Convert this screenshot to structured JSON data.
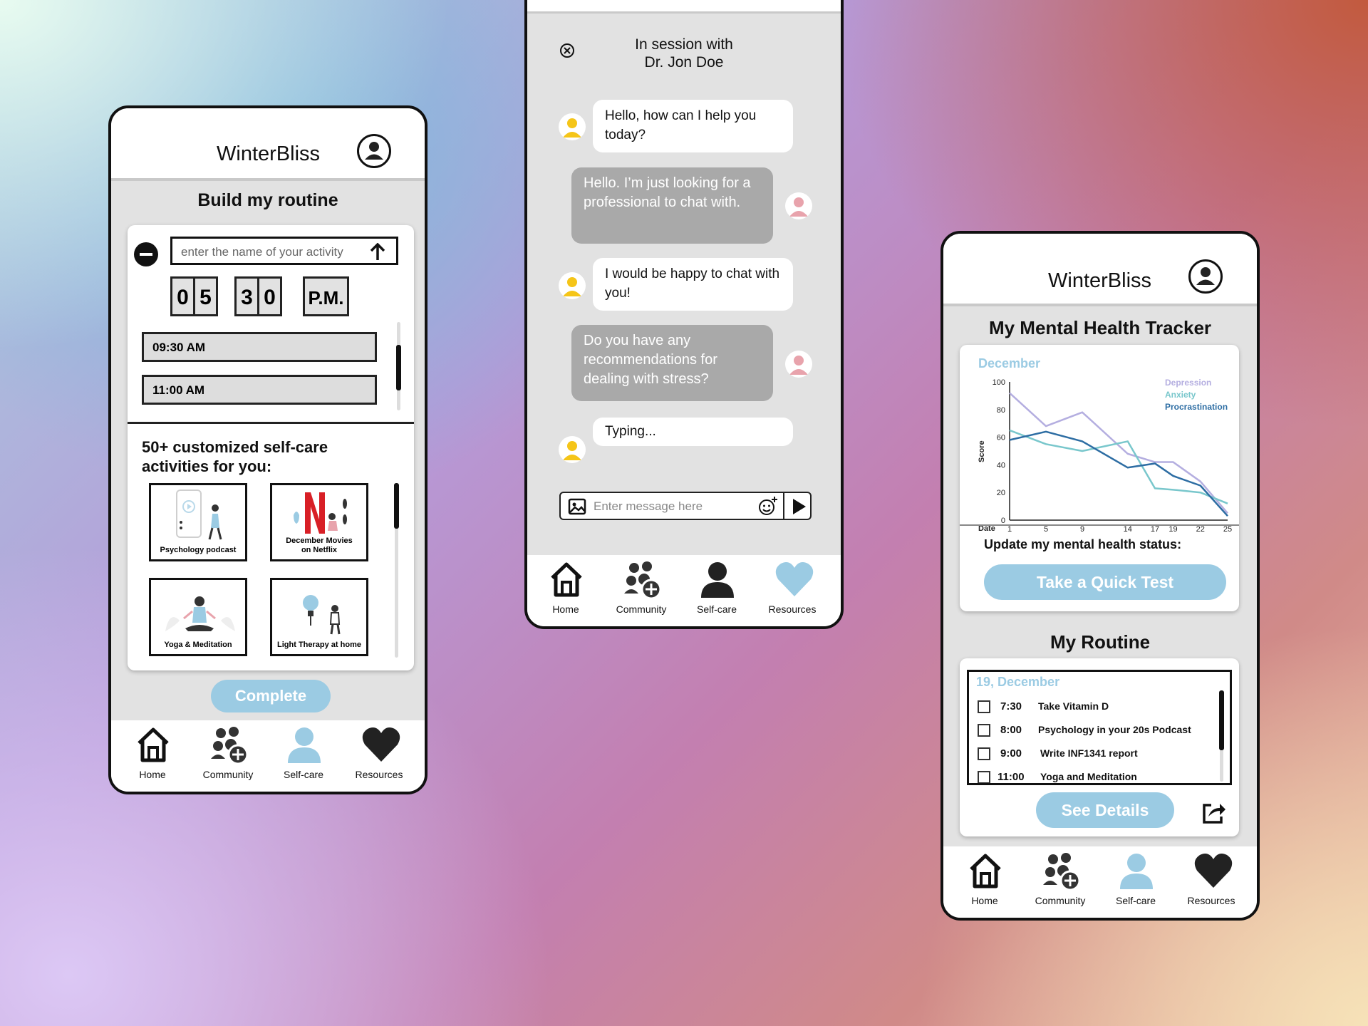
{
  "colors": {
    "accent": "#9bcbe3",
    "depression": "#b4aee0",
    "anxiety": "#79c7cc",
    "procrastination": "#2d6da3",
    "bubble_out": "#a9a9a9",
    "avatar_yellow": "#f5c518",
    "avatar_pink": "#e8a3ac"
  },
  "routine_screen": {
    "app_title": "WinterBliss",
    "heading": "Build my routine",
    "activity_input_placeholder": "enter the name of your activity",
    "time_digits": [
      "0",
      "5",
      "3",
      "0"
    ],
    "ampm": "P.M.",
    "slots": [
      "09:30 AM",
      "11:00 AM"
    ],
    "activities_heading": "50+ customized self-care activities for you:",
    "activities": [
      "Psychology podcast",
      "December Movies on Netflix",
      "Yoga & Meditation",
      "Light Therapy at home"
    ],
    "complete_label": "Complete"
  },
  "chat_screen": {
    "session_line1": "In session with",
    "session_line2": "Dr. Jon Doe",
    "messages": [
      {
        "from": "doctor",
        "text": "Hello, how can I help you today?"
      },
      {
        "from": "user",
        "text": "Hello. I’m just looking for a professional to chat with."
      },
      {
        "from": "doctor",
        "text": "I would be happy to chat with you!"
      },
      {
        "from": "user",
        "text": "Do you have any recommendations for dealing with stress?"
      },
      {
        "from": "doctor",
        "text": "Typing..."
      }
    ],
    "message_placeholder": "Enter message here"
  },
  "tracker_screen": {
    "app_title": "WinterBliss",
    "heading": "My Mental Health Tracker",
    "month": "December",
    "update_label": "Update my mental health status:",
    "quick_test_label": "Take a Quick Test",
    "routine_heading": "My Routine",
    "routine_date": "19, December",
    "routine_items": [
      {
        "time": "7:30",
        "task": "Take Vitamin D"
      },
      {
        "time": "8:00",
        "task": "Psychology in your 20s Podcast"
      },
      {
        "time": "9:00",
        "task": "Write INF1341 report"
      },
      {
        "time": "11:00",
        "task": "Yoga and Meditation"
      }
    ],
    "see_details_label": "See Details"
  },
  "nav": {
    "home": "Home",
    "community": "Community",
    "selfcare": "Self-care",
    "resources": "Resources"
  },
  "chart_data": {
    "type": "line",
    "title": "December",
    "xlabel": "Date",
    "ylabel": "Score",
    "x": [
      1,
      5,
      9,
      14,
      17,
      19,
      22,
      25
    ],
    "x_ticks": [
      "1",
      "5",
      "9",
      "14",
      "17",
      "19",
      "22",
      "25"
    ],
    "y_ticks": [
      "0",
      "20",
      "40",
      "60",
      "80",
      "100"
    ],
    "ylim": [
      0,
      100
    ],
    "legend_position": "top-right",
    "series": [
      {
        "name": "Depression",
        "color": "#b4aee0",
        "values": [
          92,
          68,
          78,
          48,
          42,
          42,
          28,
          5
        ]
      },
      {
        "name": "Anxiety",
        "color": "#79c7cc",
        "values": [
          65,
          55,
          50,
          57,
          23,
          22,
          20,
          12
        ]
      },
      {
        "name": "Procrastination",
        "color": "#2d6da3",
        "values": [
          58,
          64,
          57,
          38,
          41,
          32,
          25,
          3
        ]
      }
    ]
  }
}
